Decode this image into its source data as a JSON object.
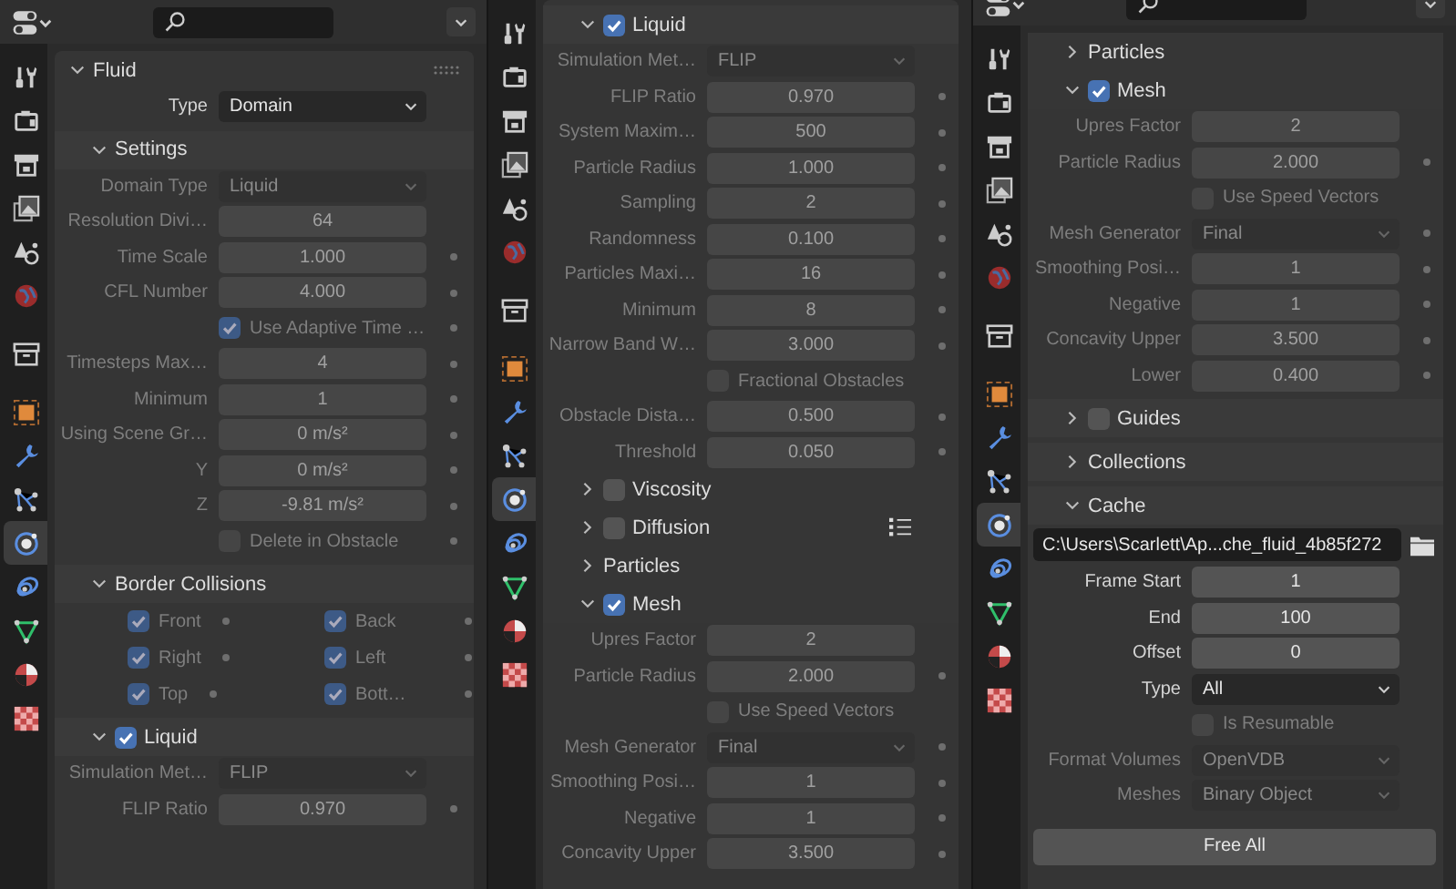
{
  "panels": [
    {
      "toolbar": {
        "cropped": false
      },
      "tabs": [
        {
          "kind": "tool",
          "selected": false
        },
        {
          "kind": "render",
          "selected": false
        },
        {
          "kind": "output",
          "selected": false
        },
        {
          "kind": "view_layer",
          "selected": false
        },
        {
          "kind": "scene",
          "selected": false
        },
        {
          "kind": "world",
          "selected": false
        },
        {
          "kind": "collection",
          "selected": false
        },
        {
          "kind": "object",
          "selected": false
        },
        {
          "kind": "modifier",
          "selected": false
        },
        {
          "kind": "particles",
          "selected": false
        },
        {
          "kind": "physics",
          "selected": true
        },
        {
          "kind": "constraints",
          "selected": false
        },
        {
          "kind": "data",
          "selected": false
        },
        {
          "kind": "material",
          "selected": false
        },
        {
          "kind": "texture",
          "selected": false
        }
      ],
      "rows": [
        {
          "kind": "panel",
          "label": "Fluid",
          "expanded": true
        },
        {
          "kind": "dropdown",
          "label": "Type",
          "value": "Domain",
          "disabled": false,
          "dot": false
        },
        {
          "kind": "subpanel",
          "label": "Settings",
          "expanded": true
        },
        {
          "kind": "dropdown",
          "label": "Domain Type",
          "value": "Liquid",
          "disabled": true,
          "dot": false
        },
        {
          "kind": "number",
          "label": "Resolution Divi…",
          "value": "64",
          "disabled": true,
          "dot": false
        },
        {
          "kind": "number",
          "label": "Time Scale",
          "value": "1.000",
          "disabled": true,
          "dot": true
        },
        {
          "kind": "number",
          "label": "CFL Number",
          "value": "4.000",
          "disabled": true,
          "dot": true
        },
        {
          "kind": "checkbox",
          "label": "Use Adaptive Time …",
          "checked": true,
          "disabled": true,
          "dot": true
        },
        {
          "kind": "number",
          "label": "Timesteps Max…",
          "value": "4",
          "disabled": true,
          "dot": true
        },
        {
          "kind": "number",
          "label": "Minimum",
          "value": "1",
          "disabled": true,
          "dot": true
        },
        {
          "kind": "number",
          "label": "Using Scene Gr…",
          "value": "0 m/s²",
          "disabled": true,
          "dot": true
        },
        {
          "kind": "number",
          "label": "Y",
          "value": "0 m/s²",
          "disabled": true,
          "dot": true
        },
        {
          "kind": "number",
          "label": "Z",
          "value": "-9.81 m/s²",
          "disabled": true,
          "dot": true
        },
        {
          "kind": "checkbox",
          "label": "Delete in Obstacle",
          "checked": false,
          "disabled": true,
          "dot": true
        },
        {
          "kind": "subpanel",
          "label": "Border Collisions",
          "expanded": true
        },
        {
          "kind": "checkpair",
          "disabled": true,
          "items": [
            {
              "label": "Front",
              "checked": true,
              "dot": true
            },
            {
              "label": "Back",
              "checked": true,
              "dot": true
            }
          ]
        },
        {
          "kind": "checkpair",
          "disabled": true,
          "items": [
            {
              "label": "Right",
              "checked": true,
              "dot": true
            },
            {
              "label": "Left",
              "checked": true,
              "dot": true
            }
          ]
        },
        {
          "kind": "checkpair",
          "disabled": true,
          "items": [
            {
              "label": "Top",
              "checked": true,
              "dot": true
            },
            {
              "label": "Bott…",
              "checked": true,
              "dot": true
            }
          ]
        },
        {
          "kind": "subpanel",
          "label": "Liquid",
          "expanded": true,
          "checked": true
        },
        {
          "kind": "dropdown",
          "label": "Simulation Met…",
          "value": "FLIP",
          "disabled": true,
          "dot": false
        },
        {
          "kind": "number",
          "label": "FLIP Ratio",
          "value": "0.970",
          "disabled": true,
          "dot": true
        }
      ]
    },
    {
      "tabs": [
        {
          "kind": "tool",
          "selected": false
        },
        {
          "kind": "render",
          "selected": false
        },
        {
          "kind": "output",
          "selected": false
        },
        {
          "kind": "view_layer",
          "selected": false
        },
        {
          "kind": "scene",
          "selected": false
        },
        {
          "kind": "world",
          "selected": false
        },
        {
          "kind": "collection",
          "selected": false
        },
        {
          "kind": "object",
          "selected": false
        },
        {
          "kind": "modifier",
          "selected": false
        },
        {
          "kind": "particles",
          "selected": false
        },
        {
          "kind": "physics",
          "selected": true
        },
        {
          "kind": "constraints",
          "selected": false
        },
        {
          "kind": "data",
          "selected": false
        },
        {
          "kind": "material",
          "selected": false
        },
        {
          "kind": "texture",
          "selected": false
        }
      ],
      "rows": [
        {
          "kind": "subpanel",
          "label": "Liquid",
          "expanded": true,
          "checked": true
        },
        {
          "kind": "dropdown",
          "label": "Simulation Met…",
          "value": "FLIP",
          "disabled": true,
          "dot": false
        },
        {
          "kind": "number",
          "label": "FLIP Ratio",
          "value": "0.970",
          "disabled": true,
          "dot": true
        },
        {
          "kind": "number",
          "label": "System Maxim…",
          "value": "500",
          "disabled": true,
          "dot": true
        },
        {
          "kind": "number",
          "label": "Particle Radius",
          "value": "1.000",
          "disabled": true,
          "dot": true
        },
        {
          "kind": "number",
          "label": "Sampling",
          "value": "2",
          "disabled": true,
          "dot": true
        },
        {
          "kind": "number",
          "label": "Randomness",
          "value": "0.100",
          "disabled": true,
          "dot": true
        },
        {
          "kind": "number",
          "label": "Particles Maxi…",
          "value": "16",
          "disabled": true,
          "dot": true
        },
        {
          "kind": "number",
          "label": "Minimum",
          "value": "8",
          "disabled": true,
          "dot": true
        },
        {
          "kind": "number",
          "label": "Narrow Band W…",
          "value": "3.000",
          "disabled": true,
          "dot": true
        },
        {
          "kind": "checkbox",
          "label": "Fractional Obstacles",
          "checked": false,
          "disabled": true,
          "dot": false
        },
        {
          "kind": "number",
          "label": "Obstacle Dista…",
          "value": "0.500",
          "disabled": true,
          "dot": true
        },
        {
          "kind": "number",
          "label": "Threshold",
          "value": "0.050",
          "disabled": true,
          "dot": true
        },
        {
          "kind": "subsubpanel",
          "label": "Viscosity",
          "expanded": false,
          "checked": false
        },
        {
          "kind": "subsubpanel",
          "label": "Diffusion",
          "expanded": false,
          "checked": false,
          "preset": true
        },
        {
          "kind": "subsubpanel",
          "label": "Particles",
          "expanded": false
        },
        {
          "kind": "subsubpanel",
          "label": "Mesh",
          "expanded": true,
          "checked": true
        },
        {
          "kind": "number",
          "label": "Upres Factor",
          "value": "2",
          "disabled": true,
          "dot": false
        },
        {
          "kind": "number",
          "label": "Particle Radius",
          "value": "2.000",
          "disabled": true,
          "dot": true
        },
        {
          "kind": "checkbox",
          "label": "Use Speed Vectors",
          "checked": false,
          "disabled": true,
          "dot": false
        },
        {
          "kind": "dropdown",
          "label": "Mesh Generator",
          "value": "Final",
          "disabled": true,
          "dot": true
        },
        {
          "kind": "number",
          "label": "Smoothing Posi…",
          "value": "1",
          "disabled": true,
          "dot": true
        },
        {
          "kind": "number",
          "label": "Negative",
          "value": "1",
          "disabled": true,
          "dot": true
        },
        {
          "kind": "number",
          "label": "Concavity Upper",
          "value": "3.500",
          "disabled": true,
          "dot": true
        }
      ]
    },
    {
      "toolbar": {
        "cropped": true
      },
      "tabs": [
        {
          "kind": "tool",
          "selected": false
        },
        {
          "kind": "render",
          "selected": false
        },
        {
          "kind": "output",
          "selected": false
        },
        {
          "kind": "view_layer",
          "selected": false
        },
        {
          "kind": "scene",
          "selected": false
        },
        {
          "kind": "world",
          "selected": false
        },
        {
          "kind": "collection",
          "selected": false
        },
        {
          "kind": "object",
          "selected": false
        },
        {
          "kind": "modifier",
          "selected": false
        },
        {
          "kind": "particles",
          "selected": false
        },
        {
          "kind": "physics",
          "selected": true
        },
        {
          "kind": "constraints",
          "selected": false
        },
        {
          "kind": "data",
          "selected": false
        },
        {
          "kind": "material",
          "selected": false
        },
        {
          "kind": "texture",
          "selected": false
        }
      ],
      "rows": [
        {
          "kind": "subsubpanel",
          "label": "Particles",
          "expanded": false
        },
        {
          "kind": "subsubpanel",
          "label": "Mesh",
          "expanded": true,
          "checked": true
        },
        {
          "kind": "number",
          "label": "Upres Factor",
          "value": "2",
          "disabled": true,
          "dot": false
        },
        {
          "kind": "number",
          "label": "Particle Radius",
          "value": "2.000",
          "disabled": true,
          "dot": true
        },
        {
          "kind": "checkbox",
          "label": "Use Speed Vectors",
          "checked": false,
          "disabled": true,
          "dot": false
        },
        {
          "kind": "dropdown",
          "label": "Mesh Generator",
          "value": "Final",
          "disabled": true,
          "dot": true
        },
        {
          "kind": "number",
          "label": "Smoothing Posi…",
          "value": "1",
          "disabled": true,
          "dot": true
        },
        {
          "kind": "number",
          "label": "Negative",
          "value": "1",
          "disabled": true,
          "dot": true
        },
        {
          "kind": "number",
          "label": "Concavity Upper",
          "value": "3.500",
          "disabled": true,
          "dot": true
        },
        {
          "kind": "number",
          "label": "Lower",
          "value": "0.400",
          "disabled": true,
          "dot": true
        },
        {
          "kind": "subpanel",
          "label": "Guides",
          "expanded": false,
          "checked": false
        },
        {
          "kind": "subpanel",
          "label": "Collections",
          "expanded": false
        },
        {
          "kind": "subpanel",
          "label": "Cache",
          "expanded": true
        },
        {
          "kind": "path",
          "value": "C:\\Users\\Scarlett\\Ap...che_fluid_4b85f272"
        },
        {
          "kind": "number",
          "label": "Frame Start",
          "value": "1",
          "disabled": false,
          "dot": false
        },
        {
          "kind": "number",
          "label": "End",
          "value": "100",
          "disabled": false,
          "dot": false
        },
        {
          "kind": "number",
          "label": "Offset",
          "value": "0",
          "disabled": false,
          "dot": false
        },
        {
          "kind": "dropdown",
          "label": "Type",
          "value": "All",
          "disabled": false,
          "dot": false
        },
        {
          "kind": "checkbox",
          "label": "Is Resumable",
          "checked": false,
          "disabled": true,
          "dot": false
        },
        {
          "kind": "dropdown",
          "label": "Format Volumes",
          "value": "OpenVDB",
          "disabled": true,
          "dot": false
        },
        {
          "kind": "dropdown",
          "label": "Meshes",
          "value": "Binary Object",
          "disabled": true,
          "dot": false
        },
        {
          "kind": "button",
          "label": "Free All"
        }
      ]
    }
  ]
}
